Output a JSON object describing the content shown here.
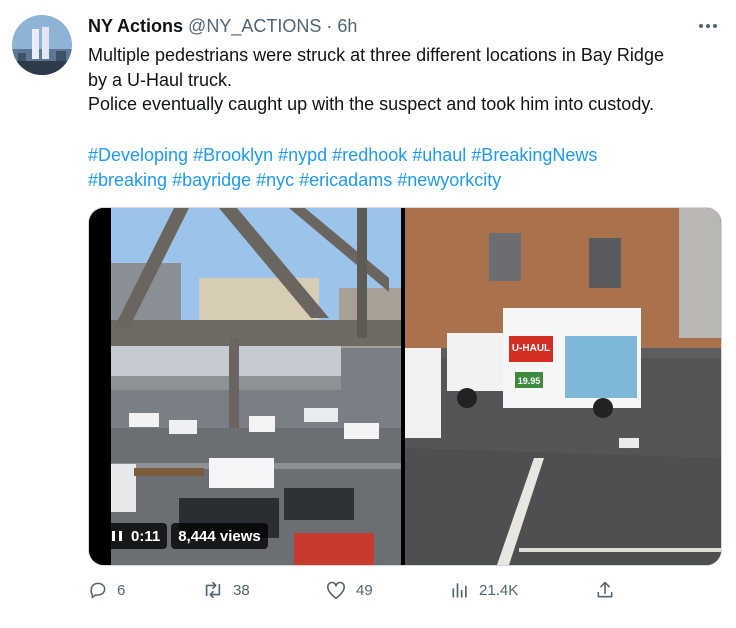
{
  "tweet": {
    "author_name": "NY Actions",
    "handle": "@NY_ACTIONS",
    "separator": "·",
    "time": "6h",
    "text_lines": [
      "Multiple pedestrians were struck at three different locations in Bay Ridge",
      "by a U-Haul truck.",
      "Police eventually caught up with the suspect and took him into custody."
    ],
    "hashtag_lines": [
      [
        "#Developing",
        "#Brooklyn",
        "#nypd",
        "#redhook",
        "#uhaul",
        "#BreakingNews"
      ],
      [
        "#breaking",
        "#bayridge",
        "#nyc",
        "#ericadams",
        "#newyorkcity"
      ]
    ],
    "media": {
      "video_time": "0:11",
      "views": "8,444 views",
      "truck_brand": "U-HAUL",
      "truck_price": "19.95"
    },
    "actions": {
      "replies": "6",
      "retweets": "38",
      "likes": "49",
      "views": "21.4K"
    }
  },
  "colors": {
    "link": "#1d9bf0",
    "secondary_text": "#536471",
    "primary_text": "#0f1419",
    "uhaul_orange": "#e0451f"
  },
  "icons": {
    "more": "more-dots-icon",
    "reply": "reply-icon",
    "retweet": "retweet-icon",
    "like": "heart-icon",
    "views": "bar-chart-icon",
    "share": "share-icon",
    "pause": "pause-icon"
  }
}
